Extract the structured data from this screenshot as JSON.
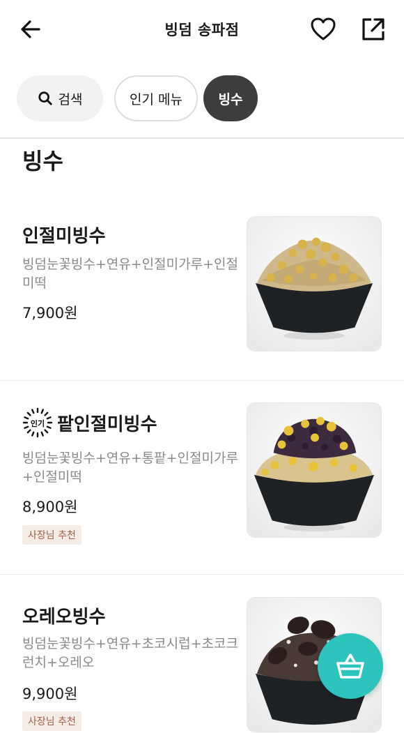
{
  "header": {
    "title": "빙덤 송파점"
  },
  "chips": {
    "search_label": "검색",
    "popular_label": "인기 메뉴",
    "active_label": "빙수"
  },
  "section": {
    "title": "빙수"
  },
  "items": [
    {
      "name": "인절미빙수",
      "desc": "빙덤눈꽃빙수+연유+인절미가루+인절미떡",
      "price": "7,900원",
      "popular": false,
      "badge": ""
    },
    {
      "name": "팥인절미빙수",
      "desc": "빙덤눈꽃빙수+연유+통팥+인절미가루+인절미떡",
      "price": "8,900원",
      "popular": true,
      "popular_label": "인기",
      "badge": "사장님 추천"
    },
    {
      "name": "오레오빙수",
      "desc": "빙덤눈꽃빙수+연유+초코시럽+초코크런치+오레오",
      "price": "9,900원",
      "popular": false,
      "badge": "사장님 추천"
    }
  ],
  "colors": {
    "accent": "#2ec4be",
    "chip_active": "#3d3d3d",
    "badge_bg": "#f5ece6",
    "badge_text": "#a0604a"
  },
  "icons": {
    "back": "arrow-left-icon",
    "favorite": "heart-icon",
    "share": "share-icon",
    "search": "search-icon",
    "cart": "basket-icon"
  }
}
